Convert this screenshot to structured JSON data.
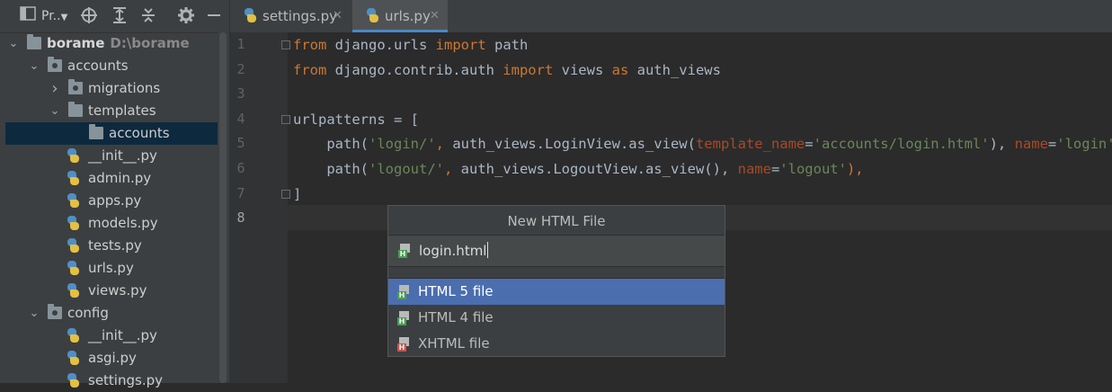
{
  "project_toolbar": {
    "view_label": "Pr..",
    "view_icon": "project-panel-icon",
    "icons": [
      "target-icon",
      "expand-all-icon",
      "collapse-all-icon",
      "gear-icon",
      "minimize-icon"
    ]
  },
  "tree": {
    "items": [
      {
        "label": "borame",
        "sub": "D:\\borame",
        "type": "folder",
        "expanded": true
      },
      {
        "label": "accounts",
        "type": "package",
        "expanded": true
      },
      {
        "label": "migrations",
        "type": "package",
        "expanded": false
      },
      {
        "label": "templates",
        "type": "folder",
        "expanded": true
      },
      {
        "label": "accounts",
        "type": "folder",
        "selected": true
      },
      {
        "label": "__init__.py",
        "type": "python"
      },
      {
        "label": "admin.py",
        "type": "python"
      },
      {
        "label": "apps.py",
        "type": "python"
      },
      {
        "label": "models.py",
        "type": "python"
      },
      {
        "label": "tests.py",
        "type": "python"
      },
      {
        "label": "urls.py",
        "type": "python"
      },
      {
        "label": "views.py",
        "type": "python"
      },
      {
        "label": "config",
        "type": "package",
        "expanded": true
      },
      {
        "label": "__init__.py",
        "type": "python"
      },
      {
        "label": "asgi.py",
        "type": "python"
      },
      {
        "label": "settings.py",
        "type": "python"
      }
    ]
  },
  "tabs": [
    {
      "label": "settings.py",
      "close": "✕",
      "active": false
    },
    {
      "label": "urls.py",
      "close": "✕",
      "active": true
    }
  ],
  "editor": {
    "line_numbers": [
      "1",
      "2",
      "3",
      "4",
      "5",
      "6",
      "7",
      "8"
    ],
    "current_line": "8",
    "lines": [
      [
        {
          "t": "from",
          "c": "kw"
        },
        {
          "t": " django.urls "
        },
        {
          "t": "import",
          "c": "kw"
        },
        {
          "t": " path"
        }
      ],
      [
        {
          "t": "from",
          "c": "kw"
        },
        {
          "t": " django.contrib.auth "
        },
        {
          "t": "import",
          "c": "kw"
        },
        {
          "t": " views "
        },
        {
          "t": "as",
          "c": "kw"
        },
        {
          "t": " auth_views"
        }
      ],
      [],
      [
        {
          "t": "urlpatterns = ["
        }
      ],
      [
        {
          "t": "    path("
        },
        {
          "t": "'login/'",
          "c": "str"
        },
        {
          "t": ", ",
          "c": "kw"
        },
        {
          "t": "auth_views.LoginView.as_view("
        },
        {
          "t": "template_name",
          "c": "param"
        },
        {
          "t": "="
        },
        {
          "t": "'accounts/login.html'",
          "c": "str"
        },
        {
          "t": "), "
        },
        {
          "t": "name",
          "c": "param"
        },
        {
          "t": "="
        },
        {
          "t": "'login'",
          "c": "str"
        },
        {
          "t": "),",
          "c": "kw"
        }
      ],
      [
        {
          "t": "    path("
        },
        {
          "t": "'logout/'",
          "c": "str"
        },
        {
          "t": ", ",
          "c": "kw"
        },
        {
          "t": "auth_views.LogoutView.as_view(), "
        },
        {
          "t": "name",
          "c": "param"
        },
        {
          "t": "="
        },
        {
          "t": "'logout'",
          "c": "str"
        },
        {
          "t": "),",
          "c": "kw"
        }
      ],
      [
        {
          "t": "]"
        }
      ],
      []
    ]
  },
  "popup": {
    "title": "New HTML File",
    "input_value": "login.html",
    "items": [
      {
        "label": "HTML 5 file",
        "icon": "html5-file-icon",
        "selected": true
      },
      {
        "label": "HTML 4 file",
        "icon": "html4-file-icon",
        "selected": false
      },
      {
        "label": "XHTML file",
        "icon": "xhtml-file-icon",
        "selected": false
      }
    ]
  },
  "colors": {
    "keyword": "#cc7832",
    "string": "#6a8759",
    "param": "#aa4926",
    "selection": "#4b6eaf"
  }
}
